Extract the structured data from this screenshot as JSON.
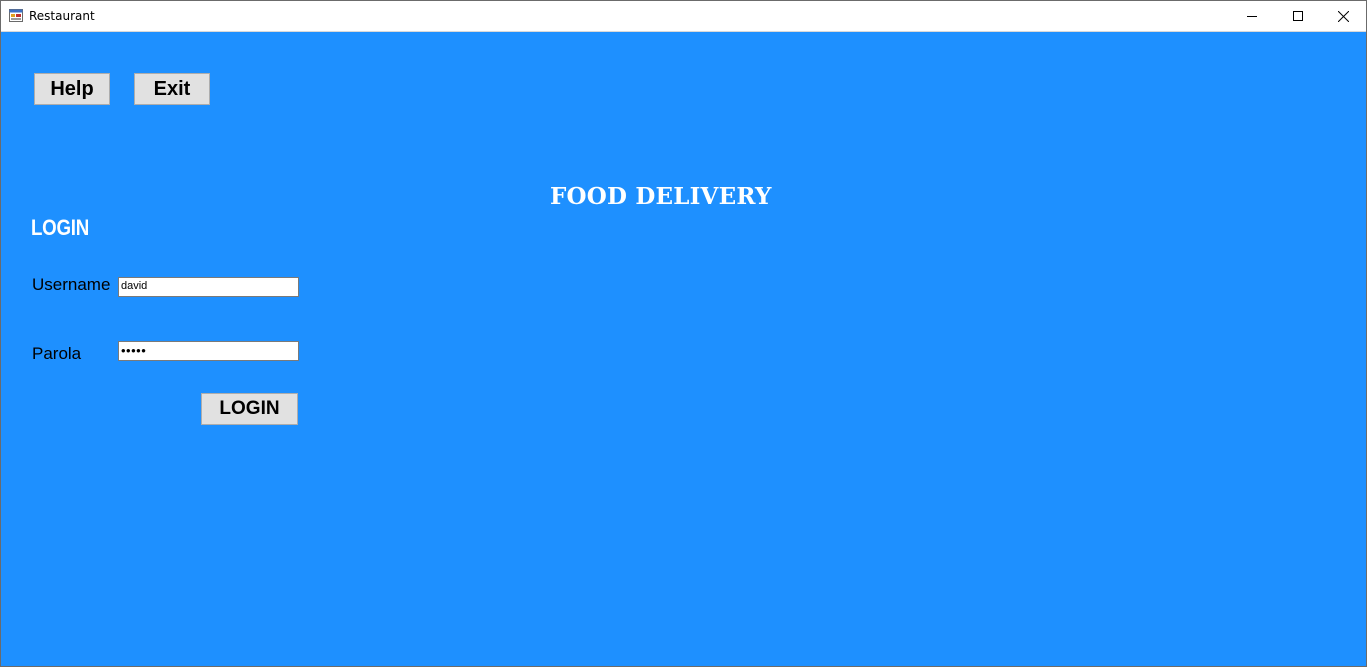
{
  "window": {
    "title": "Restaurant",
    "icon": "app-form-icon",
    "controls": {
      "minimize": "minimize-icon",
      "maximize": "maximize-icon",
      "close": "close-icon"
    }
  },
  "toolbar": {
    "help_label": "Help",
    "exit_label": "Exit"
  },
  "main": {
    "title": "FOOD DELIVERY",
    "login_heading": "LOGIN",
    "username_label": "Username",
    "username_value": "david",
    "password_label": "Parola",
    "password_value": "•••••",
    "login_button_label": "LOGIN"
  },
  "colors": {
    "background": "#1E90FF",
    "heading_text": "#FFFFFF",
    "button_face": "#E1E1E1"
  }
}
